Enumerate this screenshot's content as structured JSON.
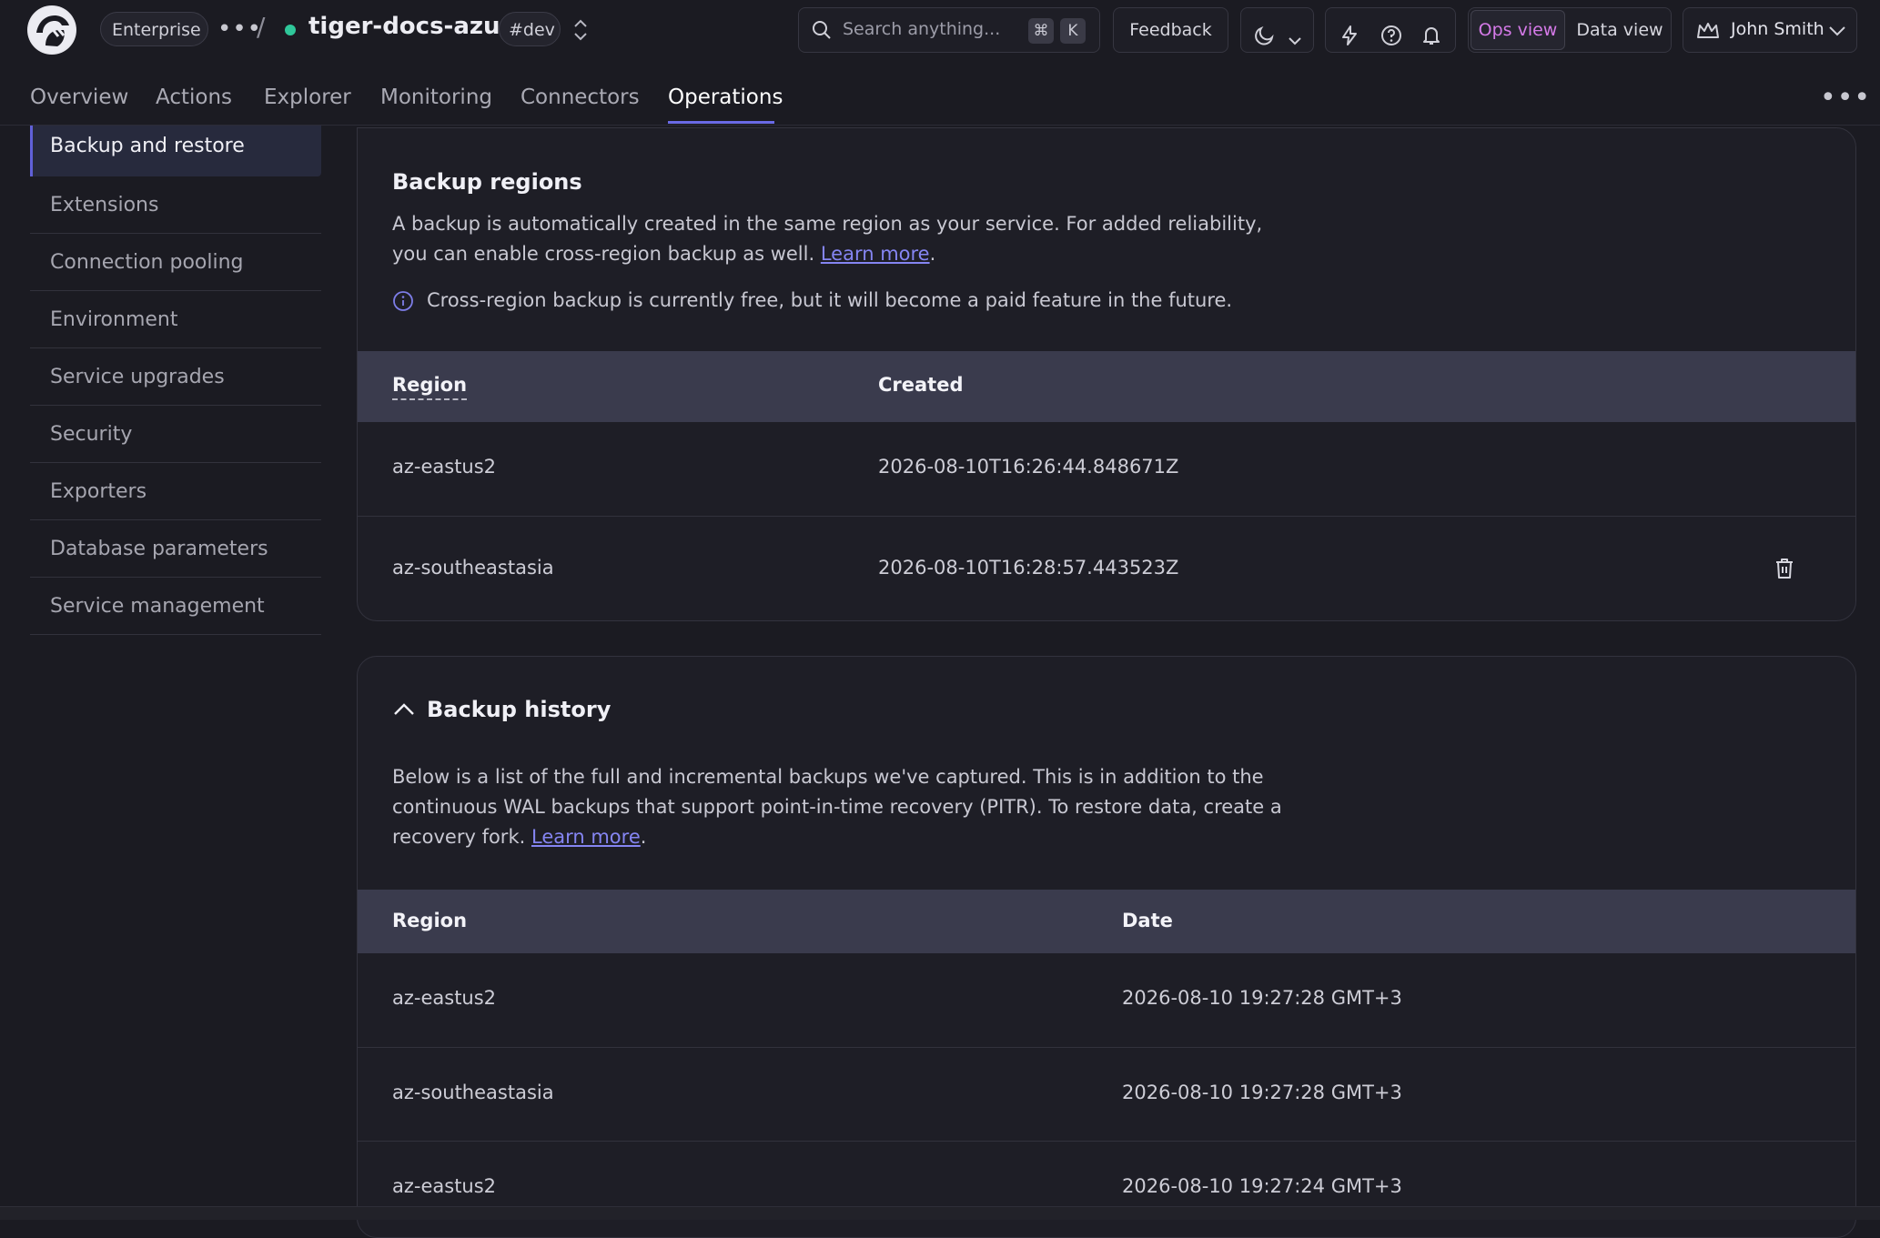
{
  "header": {
    "org_label": "Enterprise",
    "service_name": "tiger-docs-azure",
    "env_tag": "#dev",
    "search_placeholder": "Search anything...",
    "search_kbd_1": "⌘",
    "search_kbd_2": "K",
    "feedback_label": "Feedback",
    "ops_view_label": "Ops view",
    "data_view_label": "Data view",
    "user_name": "John Smith",
    "service_status_color": "#2fc79a",
    "accent_color": "#d57ae8"
  },
  "nav": {
    "tabs": [
      {
        "label": "Overview"
      },
      {
        "label": "Actions"
      },
      {
        "label": "Explorer"
      },
      {
        "label": "Monitoring"
      },
      {
        "label": "Connectors"
      },
      {
        "label": "Operations",
        "active": true
      }
    ]
  },
  "sidebar": {
    "items": [
      {
        "label": "Backup and restore",
        "active": true
      },
      {
        "label": "Extensions"
      },
      {
        "label": "Connection pooling"
      },
      {
        "label": "Environment"
      },
      {
        "label": "Service upgrades"
      },
      {
        "label": "Security"
      },
      {
        "label": "Exporters"
      },
      {
        "label": "Database parameters"
      },
      {
        "label": "Service management"
      }
    ]
  },
  "backup_regions": {
    "title": "Backup regions",
    "description": "A backup is automatically created in the same region as your service. For added reliability, you can enable cross-region backup as well.",
    "learn_more": "Learn more",
    "info_note": "Cross-region backup is currently free, but it will become a paid feature in the future.",
    "columns": [
      "Region",
      "Created"
    ],
    "rows": [
      {
        "region": "az-eastus2",
        "created": "2026-08-10T16:26:44.848671Z"
      },
      {
        "region": "az-southeastasia",
        "created": "2026-08-10T16:28:57.443523Z"
      }
    ]
  },
  "backup_history": {
    "title": "Backup history",
    "description": "Below is a list of the full and incremental backups we've captured. This is in addition to the continuous WAL backups that support point-in-time recovery (PITR). To restore data, create a recovery fork.",
    "learn_more": "Learn more",
    "columns": [
      "Region",
      "Date"
    ],
    "rows": [
      {
        "region": "az-eastus2",
        "date": "2026-08-10 19:27:28 GMT+3"
      },
      {
        "region": "az-southeastasia",
        "date": "2026-08-10 19:27:28 GMT+3"
      },
      {
        "region": "az-eastus2",
        "date": "2026-08-10 19:27:24 GMT+3"
      }
    ]
  }
}
